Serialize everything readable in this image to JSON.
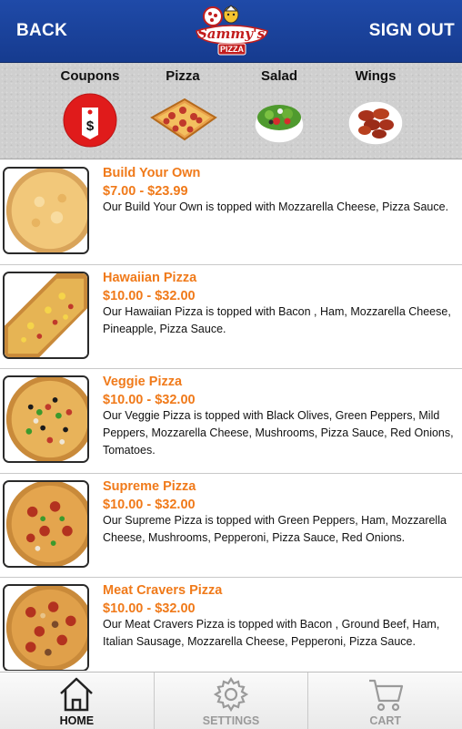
{
  "header": {
    "back_label": "BACK",
    "signout_label": "SIGN OUT",
    "logo_text": "Sammy's",
    "logo_sub": "PIZZA"
  },
  "categories": [
    {
      "label": "Coupons",
      "icon": "coupon-tag-icon"
    },
    {
      "label": "Pizza",
      "icon": "pizza-slice-image"
    },
    {
      "label": "Salad",
      "icon": "salad-bowl-image"
    },
    {
      "label": "Wings",
      "icon": "wings-plate-image"
    }
  ],
  "menu": {
    "items": [
      {
        "name": "Build Your Own",
        "price": "$7.00 - $23.99",
        "description": "Our Build Your Own is topped with Mozzarella Cheese, Pizza Sauce."
      },
      {
        "name": "Hawaiian Pizza",
        "price": "$10.00 - $32.00",
        "description": "Our Hawaiian Pizza is topped with Bacon , Ham, Mozzarella Cheese, Pineapple, Pizza Sauce."
      },
      {
        "name": "Veggie Pizza",
        "price": "$10.00 - $32.00",
        "description": "Our Veggie Pizza is topped with Black Olives, Green Peppers, Mild Peppers, Mozzarella Cheese, Mushrooms, Pizza Sauce, Red Onions, Tomatoes."
      },
      {
        "name": "Supreme Pizza",
        "price": "$10.00 - $32.00",
        "description": "Our Supreme Pizza is topped with Green Peppers, Ham, Mozzarella Cheese, Mushrooms, Pepperoni, Pizza Sauce, Red Onions."
      },
      {
        "name": "Meat Cravers Pizza",
        "price": "$10.00 - $32.00",
        "description": "Our Meat Cravers Pizza is topped with Bacon , Ground Beef, Ham, Italian Sausage, Mozzarella Cheese, Pepperoni, Pizza Sauce."
      }
    ]
  },
  "bottom_nav": [
    {
      "label": "HOME",
      "icon": "home-icon",
      "active": true
    },
    {
      "label": "SETTINGS",
      "icon": "gear-icon",
      "active": false
    },
    {
      "label": "CART",
      "icon": "cart-icon",
      "active": false
    }
  ],
  "colors": {
    "header_blue": "#1f4aa8",
    "accent_orange": "#f07a1a",
    "coupon_red": "#e01b1b"
  }
}
